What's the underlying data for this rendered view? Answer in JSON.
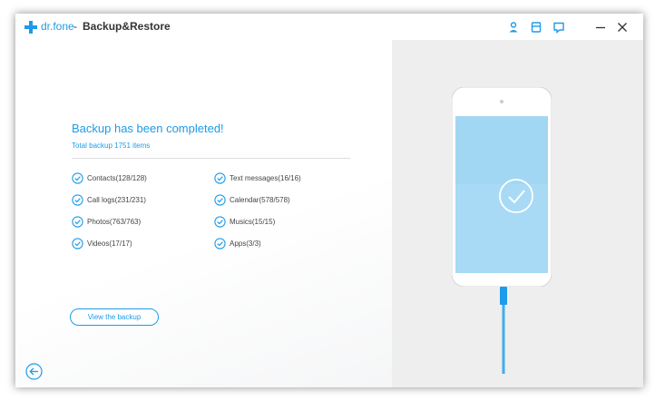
{
  "window": {
    "brand": "dr.fone",
    "separator": "-",
    "title": "Backup&Restore",
    "icons": [
      "user-icon",
      "save-icon",
      "feedback-icon",
      "minimize-icon",
      "close-icon"
    ]
  },
  "main": {
    "headline": "Backup has been completed!",
    "subtitle": "Total backup 1751 items",
    "items": [
      {
        "label": "Contacts(128/128)"
      },
      {
        "label": "Text messages(16/16)"
      },
      {
        "label": "Call logs(231/231)"
      },
      {
        "label": "Calendar(578/578)"
      },
      {
        "label": "Photos(763/763)"
      },
      {
        "label": "Musics(15/15)"
      },
      {
        "label": "Videos(17/17)"
      },
      {
        "label": "Apps(3/3)"
      }
    ],
    "view_button": "View the backup",
    "back_icon": "back-arrow-icon"
  },
  "colors": {
    "accent": "#1e9be8",
    "right_panel": "#eeeeee",
    "phone_screen": "#a8daf5"
  }
}
